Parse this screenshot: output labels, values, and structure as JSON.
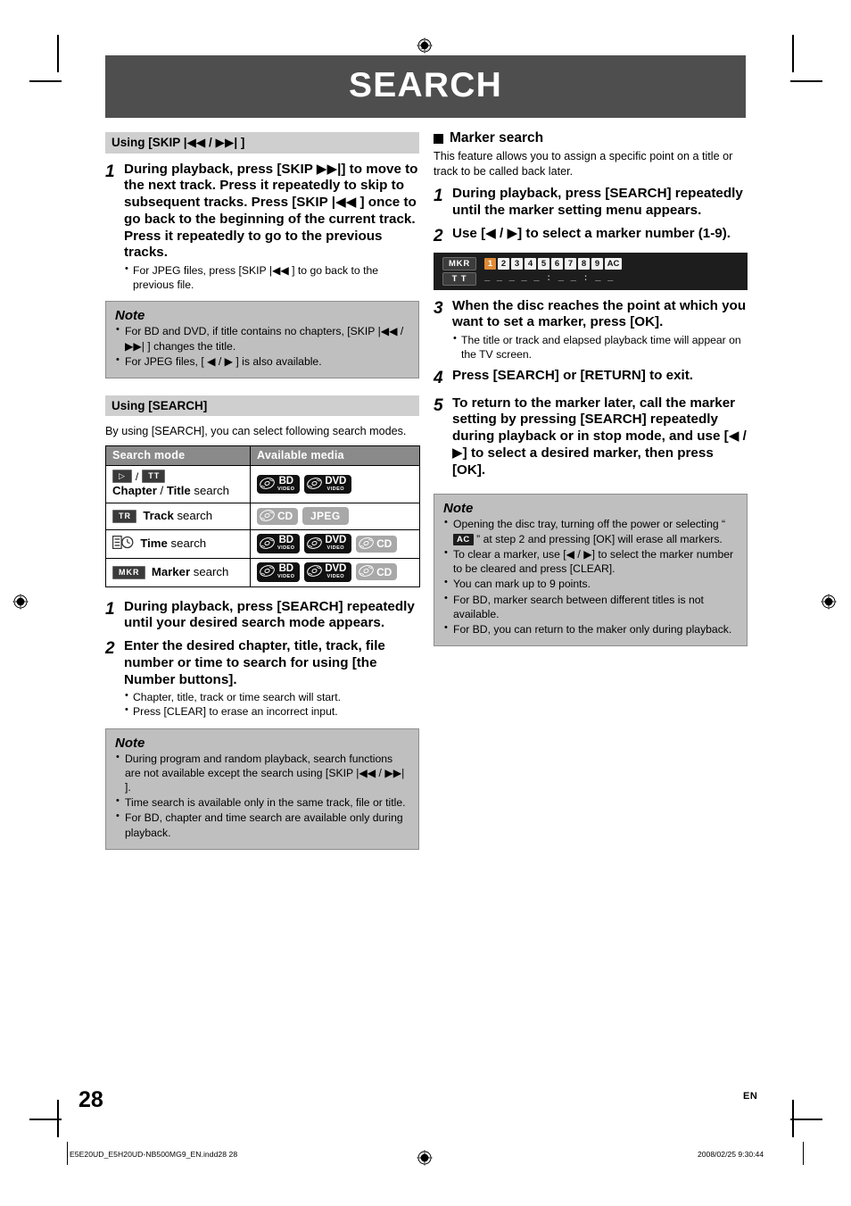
{
  "document": {
    "title": "SEARCH",
    "page_number": "28",
    "language_mark": "EN",
    "footer_left": "E5E20UD_E5H20UD-NB500MG9_EN.indd28   28",
    "footer_right": "2008/02/25   9:30:44"
  },
  "colors": {
    "title_band": "#4e4e4e",
    "section_header": "#cfcfcf",
    "note_bg": "#bfbfbf",
    "note_border": "#8d8d8d",
    "table_header": "#8a8a8a",
    "osd_bg": "#1d1d1d",
    "osd_selected": "#e08a36",
    "badge_dark": "#111111",
    "badge_grey": "#a8a8a8"
  },
  "left_column": {
    "skip_section": {
      "header": "Using [SKIP |◀◀ / ▶▶| ]",
      "steps": [
        {
          "number": "1",
          "text": "During playback, press [SKIP ▶▶|] to move to the next track. Press it repeatedly to skip to subsequent tracks. Press [SKIP |◀◀ ] once to go back to the beginning of the current track. Press it repeatedly to go to the previous tracks.",
          "bullets": [
            "For JPEG files, press [SKIP |◀◀ ] to go back to the previous file."
          ]
        }
      ],
      "note": {
        "title": "Note",
        "items": [
          "For BD and DVD, if title contains no chapters, [SKIP |◀◀ / ▶▶| ] changes the title.",
          "For JPEG files,  [ ◀ / ▶ ] is also available."
        ]
      }
    },
    "search_section": {
      "header": "Using [SEARCH]",
      "intro": "By using [SEARCH], you can select following search modes.",
      "table": {
        "columns": [
          "Search mode",
          "Available media"
        ],
        "rows": [
          {
            "icons": [
              "play-key",
              "tt-key"
            ],
            "label": "Chapter / Title search",
            "label_bold": [
              "Chapter",
              "Title"
            ],
            "media": [
              "BD Video",
              "DVD Video"
            ]
          },
          {
            "icons": [
              "tr-key"
            ],
            "label": "Track search",
            "label_bold": [
              "Track"
            ],
            "media": [
              "CD",
              "JPEG"
            ]
          },
          {
            "icons": [
              "time-key"
            ],
            "label": "Time search",
            "label_bold": [
              "Time"
            ],
            "media": [
              "BD Video",
              "DVD Video",
              "CD"
            ]
          },
          {
            "icons": [
              "mkr-key"
            ],
            "label": "Marker search",
            "label_bold": [
              "Marker"
            ],
            "media": [
              "BD Video",
              "DVD Video",
              "CD"
            ]
          }
        ]
      },
      "steps": [
        {
          "number": "1",
          "text": "During playback, press [SEARCH] repeatedly until your desired search mode appears.",
          "bullets": []
        },
        {
          "number": "2",
          "text": "Enter the desired chapter, title, track, file number or time to search for using [the Number buttons].",
          "bullets": [
            "Chapter, title, track or time search will start.",
            "Press [CLEAR] to erase an incorrect input."
          ]
        }
      ],
      "note": {
        "title": "Note",
        "items": [
          "During program and random playback, search functions are not available except the search using [SKIP |◀◀ / ▶▶| ].",
          "Time search is available only in the same track, file or title.",
          "For BD, chapter and time search are available only during playback."
        ]
      }
    }
  },
  "right_column": {
    "marker_section": {
      "heading": "Marker search",
      "intro": "This feature allows you to assign a specific point on a title or track to be called back later.",
      "steps": [
        {
          "number": "1",
          "text": "During playback, press [SEARCH] repeatedly until the marker setting menu appears.",
          "bullets": []
        },
        {
          "number": "2",
          "text": "Use [◀ / ▶] to select a marker number (1-9).",
          "bullets": []
        },
        {
          "number": "3",
          "text": "When the disc reaches the point at which you want to set a marker, press [OK].",
          "bullets": [
            "The title or track and elapsed playback time will appear on the TV screen."
          ]
        },
        {
          "number": "4",
          "text": "Press [SEARCH] or [RETURN] to exit.",
          "bullets": []
        },
        {
          "number": "5",
          "text": "To return to the marker later, call the marker setting by pressing [SEARCH] repeatedly during playback or in stop mode, and use [◀ / ▶] to select a desired marker, then press [OK].",
          "bullets": []
        }
      ],
      "osd": {
        "tag_top": "MKR",
        "tag_bottom": "T T",
        "numbers": [
          "1",
          "2",
          "3",
          "4",
          "5",
          "6",
          "7",
          "8",
          "9"
        ],
        "selected_number": "1",
        "clear_all_label": "AC",
        "time_display": "_ _ _    _ _ : _ _ : _ _"
      },
      "note": {
        "title": "Note",
        "items": [
          {
            "pre": "Opening the disc tray, turning off the power or selecting “ ",
            "chip": "AC",
            "post": " ” at step 2 and pressing [OK] will erase all markers."
          },
          {
            "pre": "To clear a marker, use [◀ / ▶] to select the marker number to be cleared and press [CLEAR].",
            "chip": "",
            "post": ""
          },
          {
            "pre": "You can mark up to 9 points.",
            "chip": "",
            "post": ""
          },
          {
            "pre": "For BD, marker search between different titles is not available.",
            "chip": "",
            "post": ""
          },
          {
            "pre": "For BD, you can return to the maker only during playback.",
            "chip": "",
            "post": ""
          }
        ]
      }
    }
  }
}
